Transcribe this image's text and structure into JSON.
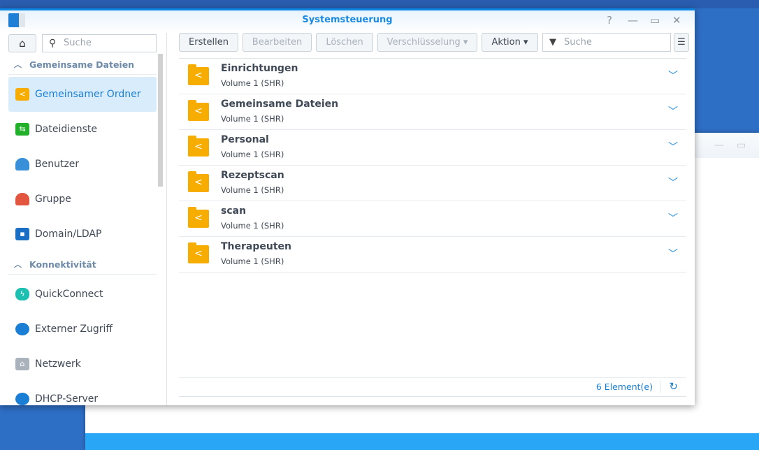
{
  "window": {
    "title": "Systemsteuerung",
    "help": "?",
    "minimize": "—",
    "maximize": "▭",
    "close": "✕"
  },
  "sidebar": {
    "search_placeholder": "Suche",
    "sections": [
      {
        "label": "Gemeinsame Dateien"
      },
      {
        "label": "Konnektivität"
      }
    ],
    "items": [
      {
        "label": "Gemeinsamer Ordner"
      },
      {
        "label": "Dateidienste"
      },
      {
        "label": "Benutzer"
      },
      {
        "label": "Gruppe"
      },
      {
        "label": "Domain/LDAP"
      },
      {
        "label": "QuickConnect"
      },
      {
        "label": "Externer Zugriff"
      },
      {
        "label": "Netzwerk"
      },
      {
        "label": "DHCP-Server"
      }
    ]
  },
  "toolbar": {
    "create": "Erstellen",
    "edit": "Bearbeiten",
    "delete": "Löschen",
    "encryption": "Verschlüsselung ▾",
    "action": "Aktion ▾",
    "search_placeholder": "Suche"
  },
  "folders": [
    {
      "name": "Einrichtungen",
      "location": "Volume 1 (SHR)"
    },
    {
      "name": "Gemeinsame Dateien",
      "location": "Volume 1 (SHR)"
    },
    {
      "name": "Personal",
      "location": "Volume 1 (SHR)"
    },
    {
      "name": "Rezeptscan",
      "location": "Volume 1 (SHR)"
    },
    {
      "name": "scan",
      "location": "Volume 1 (SHR)"
    },
    {
      "name": "Therapeuten",
      "location": "Volume 1 (SHR)"
    }
  ],
  "footer": {
    "count": "6 Element(e)"
  }
}
